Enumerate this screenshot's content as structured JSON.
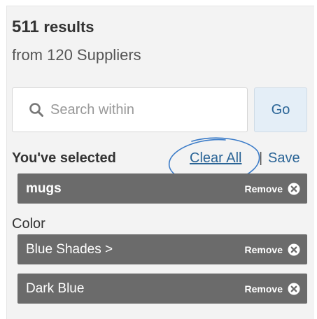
{
  "results": {
    "count": "511",
    "word": "results",
    "suppliers": "from 120 Suppliers"
  },
  "search": {
    "placeholder": "Search within",
    "go_label": "Go"
  },
  "selected": {
    "heading": "You've selected",
    "clear_all": "Clear All",
    "separator": "|",
    "save": "Save",
    "chips": [
      {
        "label": "mugs",
        "remove": "Remove"
      }
    ]
  },
  "color": {
    "heading": "Color",
    "chips": [
      {
        "label": "Blue Shades >",
        "remove": "Remove"
      },
      {
        "label": "Dark Blue",
        "remove": "Remove"
      }
    ]
  },
  "colors": {
    "chip_bg": "#6b6b6b",
    "link": "#2a6496",
    "annotation": "#3a7bc8",
    "go_bg": "#e4eef7"
  }
}
